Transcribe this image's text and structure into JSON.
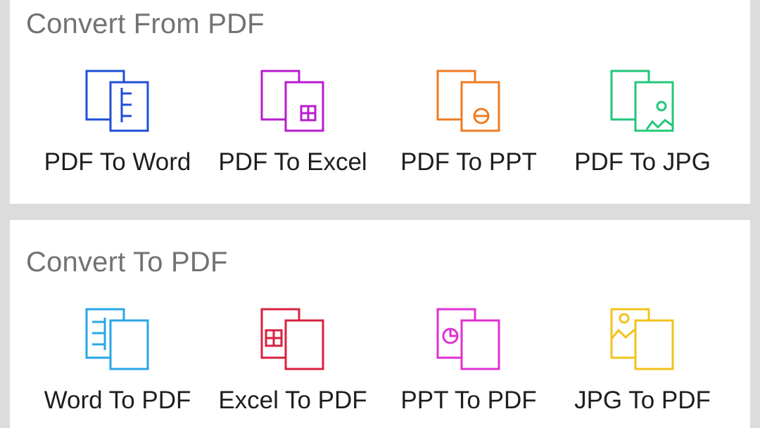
{
  "from_section": {
    "title": "Convert From PDF",
    "items": [
      {
        "label": "PDF To Word",
        "icon": "pdf-to-word-icon",
        "color": "#1f4fd6"
      },
      {
        "label": "PDF To Excel",
        "icon": "pdf-to-excel-icon",
        "color": "#b71ccd"
      },
      {
        "label": "PDF To PPT",
        "icon": "pdf-to-ppt-icon",
        "color": "#ef7b22"
      },
      {
        "label": "PDF To JPG",
        "icon": "pdf-to-jpg-icon",
        "color": "#22c77a"
      }
    ]
  },
  "to_section": {
    "title": "Convert To PDF",
    "items": [
      {
        "label": "Word To PDF",
        "icon": "word-to-pdf-icon",
        "color": "#27a7e6"
      },
      {
        "label": "Excel To PDF",
        "icon": "excel-to-pdf-icon",
        "color": "#d9213f"
      },
      {
        "label": "PPT To PDF",
        "icon": "ppt-to-pdf-icon",
        "color": "#e030d2"
      },
      {
        "label": "JPG To PDF",
        "icon": "jpg-to-pdf-icon",
        "color": "#f3c21b"
      }
    ]
  }
}
